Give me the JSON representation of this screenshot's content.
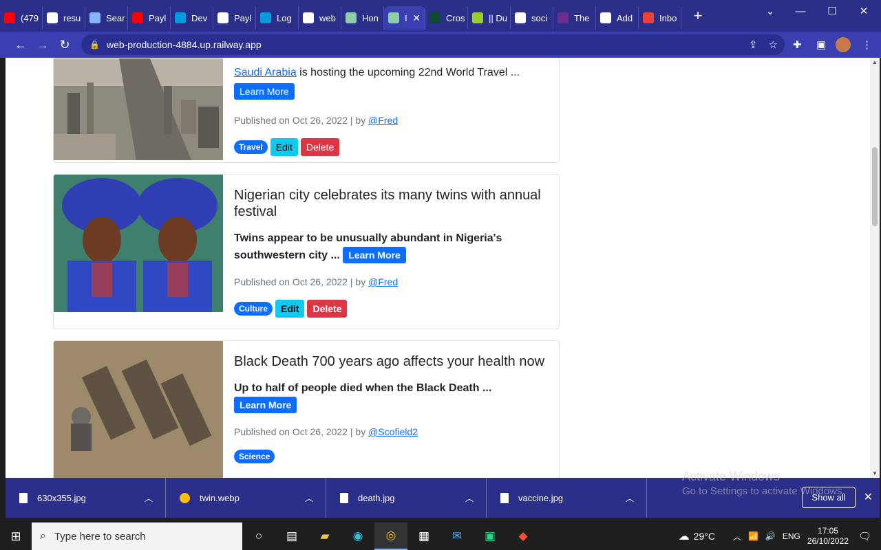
{
  "tabs": [
    {
      "label": "(479",
      "icon": "youtube-icon",
      "color": "#ff0000"
    },
    {
      "label": "resu",
      "icon": "github-icon",
      "color": "#ffffff"
    },
    {
      "label": "Sear",
      "icon": "flag-icon",
      "color": "#8ab4f8"
    },
    {
      "label": "Payl",
      "icon": "youtube-icon",
      "color": "#ff0000"
    },
    {
      "label": "Dev",
      "icon": "paypal-icon",
      "color": "#009cde"
    },
    {
      "label": "Payl",
      "icon": "globe-icon",
      "color": "#ffffff"
    },
    {
      "label": "Log",
      "icon": "paypal-icon",
      "color": "#009cde"
    },
    {
      "label": "web",
      "icon": "railway-icon",
      "color": "#ffffff"
    },
    {
      "label": "Hon",
      "icon": "doc-icon",
      "color": "#8ed1a8"
    },
    {
      "label": "I",
      "icon": "doc-icon",
      "color": "#8ed1a8",
      "active": true
    },
    {
      "label": "Cros",
      "icon": "django-icon",
      "color": "#0c4b33"
    },
    {
      "label": "|| Du",
      "icon": "square-icon",
      "color": "#9acd32"
    },
    {
      "label": "soci",
      "icon": "github-icon",
      "color": "#ffffff"
    },
    {
      "label": "The",
      "icon": "rand-icon",
      "color": "#6a2c91"
    },
    {
      "label": "Add",
      "icon": "globe-icon",
      "color": "#ffffff"
    },
    {
      "label": "Inbo",
      "icon": "gmail-icon",
      "color": "#ea4335"
    }
  ],
  "url": "web-production-4884.up.railway.app",
  "posts": [
    {
      "title": "",
      "excerpt_link": "Saudi Arabia",
      "excerpt": " is hosting the upcoming 22nd World Travel ...",
      "learn_more": "Learn More",
      "meta_prefix": "Published on Oct 26, 2022 | by ",
      "author": "@Fred",
      "category": "Travel",
      "edit": "Edit",
      "delete": "Delete"
    },
    {
      "title": "Nigerian city celebrates its many twins with annual festival",
      "excerpt": "Twins appear to be unusually abundant in Nigeria's southwestern city ...",
      "learn_more": "Learn More",
      "meta_prefix": "Published on Oct 26, 2022 | by ",
      "author": "@Fred",
      "category": "Culture",
      "edit": "Edit",
      "delete": "Delete"
    },
    {
      "title": "Black Death 700 years ago affects your health now",
      "excerpt": "Up to half of people died when the Black Death ...",
      "learn_more": "Learn More",
      "meta_prefix": "Published on Oct 26, 2022 | by ",
      "author": "@Scofield2",
      "category": "Science"
    }
  ],
  "downloads": [
    {
      "name": "630x355.jpg",
      "icon": "file-icon"
    },
    {
      "name": "twin.webp",
      "icon": "chrome-icon"
    },
    {
      "name": "death.jpg",
      "icon": "file-icon"
    },
    {
      "name": "vaccine.jpg",
      "icon": "file-icon"
    }
  ],
  "show_all": "Show all",
  "watermark": {
    "line1": "Activate Windows",
    "line2": "Go to Settings to activate Windows."
  },
  "taskbar": {
    "search_placeholder": "Type here to search",
    "weather": "29°C",
    "lang": "ENG",
    "time": "17:05",
    "date": "26/10/2022"
  }
}
